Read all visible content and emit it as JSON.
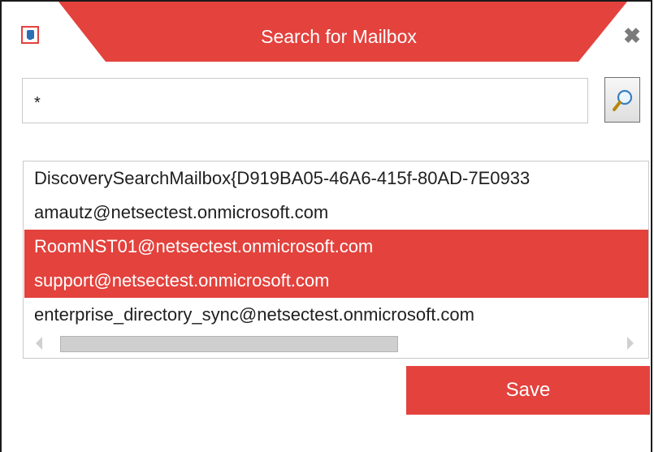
{
  "window": {
    "title": "Search for Mailbox",
    "close_glyph": "✖",
    "accent_color": "#e3423d",
    "icons": {
      "app": "outlook-mailbox-icon",
      "close": "close-icon",
      "search": "search-icon"
    }
  },
  "search": {
    "value": "*"
  },
  "mailboxes": {
    "items": [
      {
        "label": "DiscoverySearchMailbox{D919BA05-46A6-415f-80AD-7E0933",
        "selected": false
      },
      {
        "label": "amautz@netsectest.onmicrosoft.com",
        "selected": false
      },
      {
        "label": "RoomNST01@netsectest.onmicrosoft.com",
        "selected": true
      },
      {
        "label": "support@netsectest.onmicrosoft.com",
        "selected": true
      },
      {
        "label": "enterprise_directory_sync@netsectest.onmicrosoft.com",
        "selected": false
      }
    ]
  },
  "actions": {
    "save_label": "Save"
  }
}
